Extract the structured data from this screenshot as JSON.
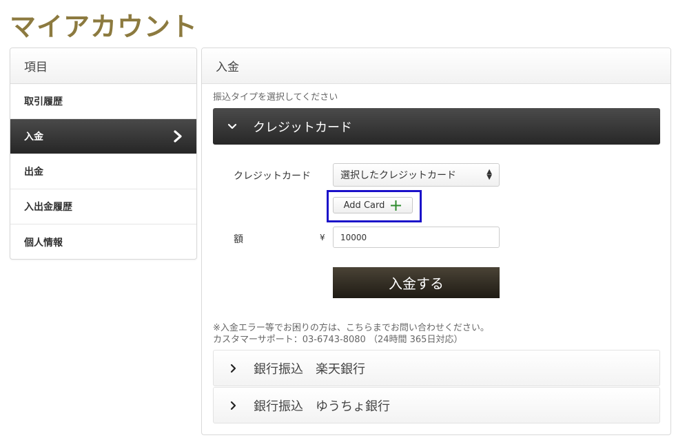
{
  "page": {
    "title": "マイアカウント"
  },
  "sidebar": {
    "header": "項目",
    "items": [
      {
        "label": "取引履歴"
      },
      {
        "label": "入金"
      },
      {
        "label": "出金"
      },
      {
        "label": "入出金履歴"
      },
      {
        "label": "個人情報"
      }
    ]
  },
  "main": {
    "header": "入金",
    "instruction": "振込タイプを選択してください",
    "sections": [
      {
        "label": "クレジットカード",
        "state": "expanded"
      },
      {
        "label": "銀行振込　楽天銀行",
        "state": "collapsed"
      },
      {
        "label": "銀行振込　ゆうちょ銀行",
        "state": "collapsed"
      }
    ],
    "form": {
      "card_label": "クレジットカード",
      "card_select_value": "選択したクレジットカード",
      "add_card_label": "Add Card",
      "amount_label": "額",
      "currency_symbol": "¥",
      "amount_value": "10000",
      "submit_label": "入金する"
    },
    "note_line1": "※入金エラー等でお困りの方は、こちらまでお問い合わせください。",
    "note_line2": "カスタマーサポート：03-6743-8080 （24時間 365日対応）"
  },
  "colors": {
    "title_gold": "#8c7a3f",
    "active_dark": "#262626",
    "highlight_blue": "#1a10c9",
    "plus_green": "#2e8b2e"
  }
}
